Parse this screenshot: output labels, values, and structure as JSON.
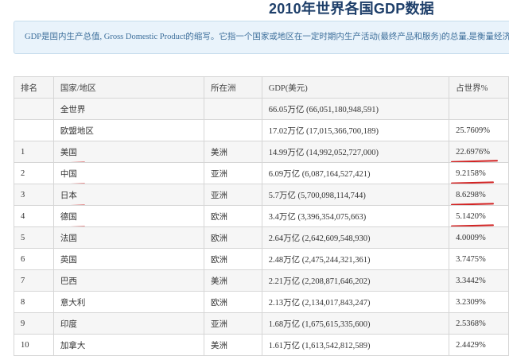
{
  "title": "2010年世界各国GDP数据",
  "info_text": "GDP是国内生产总值, Gross Domestic Product的缩写。它指一个国家或地区在一定时期内生产活动(最终产品和服务)的总量,是衡量经济规",
  "table": {
    "headers": [
      "排名",
      "国家/地区",
      "所在洲",
      "GDP(美元)",
      "占世界%"
    ],
    "rows": [
      {
        "rank": "",
        "country": "全世界",
        "continent": "",
        "gdp": "66.05万亿 (66,051,180,948,591)",
        "share": "",
        "marked": false
      },
      {
        "rank": "",
        "country": "欧盟地区",
        "continent": "",
        "gdp": "17.02万亿 (17,015,366,700,189)",
        "share": "25.7609%",
        "marked": false
      },
      {
        "rank": "1",
        "country": "美国",
        "continent": "美洲",
        "gdp": "14.99万亿 (14,992,052,727,000)",
        "share": "22.6976%",
        "marked": true
      },
      {
        "rank": "2",
        "country": "中国",
        "continent": "亚洲",
        "gdp": "6.09万亿 (6,087,164,527,421)",
        "share": "9.2158%",
        "marked": true
      },
      {
        "rank": "3",
        "country": "日本",
        "continent": "亚洲",
        "gdp": "5.7万亿 (5,700,098,114,744)",
        "share": "8.6298%",
        "marked": true
      },
      {
        "rank": "4",
        "country": "德国",
        "continent": "欧洲",
        "gdp": "3.4万亿 (3,396,354,075,663)",
        "share": "5.1420%",
        "marked": true
      },
      {
        "rank": "5",
        "country": "法国",
        "continent": "欧洲",
        "gdp": "2.64万亿 (2,642,609,548,930)",
        "share": "4.0009%",
        "marked": false
      },
      {
        "rank": "6",
        "country": "英国",
        "continent": "欧洲",
        "gdp": "2.48万亿 (2,475,244,321,361)",
        "share": "3.7475%",
        "marked": false
      },
      {
        "rank": "7",
        "country": "巴西",
        "continent": "美洲",
        "gdp": "2.21万亿 (2,208,871,646,202)",
        "share": "3.3442%",
        "marked": false
      },
      {
        "rank": "8",
        "country": "意大利",
        "continent": "欧洲",
        "gdp": "2.13万亿 (2,134,017,843,247)",
        "share": "3.2309%",
        "marked": false
      },
      {
        "rank": "9",
        "country": "印度",
        "continent": "亚洲",
        "gdp": "1.68万亿 (1,675,615,335,600)",
        "share": "2.5368%",
        "marked": false
      },
      {
        "rank": "10",
        "country": "加拿大",
        "continent": "美洲",
        "gdp": "1.61万亿 (1,613,542,812,589)",
        "share": "2.4429%",
        "marked": false
      }
    ]
  },
  "colors": {
    "title": "#1e3f6a",
    "info_bg": "#e9f3fb",
    "info_text": "#3d6f9b",
    "annotation": "#d22323"
  }
}
